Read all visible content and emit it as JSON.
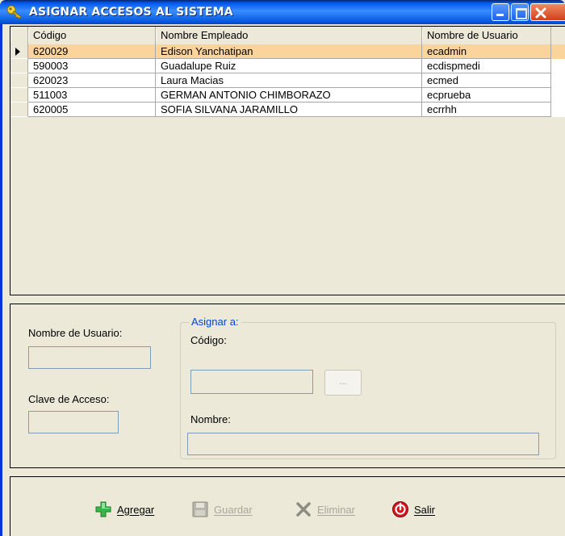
{
  "window": {
    "title": "ASIGNAR ACCESOS AL SISTEMA"
  },
  "grid": {
    "columns": [
      "Código",
      "Nombre Empleado",
      "Nombre de Usuario"
    ],
    "rows": [
      {
        "codigo": "620029",
        "nombre": "Edison Yanchatipan",
        "usuario": "ecadmin"
      },
      {
        "codigo": "590003",
        "nombre": "Guadalupe Ruiz",
        "usuario": "ecdispmedi"
      },
      {
        "codigo": "620023",
        "nombre": "Laura Macias",
        "usuario": "ecmed"
      },
      {
        "codigo": "511003",
        "nombre": "GERMAN ANTONIO CHIMBORAZO",
        "usuario": "ecprueba"
      },
      {
        "codigo": "620005",
        "nombre": "SOFIA SILVANA JARAMILLO",
        "usuario": "ecrrhh"
      }
    ],
    "selected_row": 0
  },
  "form": {
    "usuario_label": "Nombre de Usuario:",
    "usuario_value": "",
    "clave_label": "Clave de Acceso:",
    "clave_value": "",
    "group_title": "Asignar a:",
    "codigo_label": "Código:",
    "codigo_value": "",
    "browse_label": "...",
    "nombre_label": "Nombre:",
    "nombre_value": ""
  },
  "toolbar": {
    "agregar": "Agregar",
    "guardar": "Guardar",
    "eliminar": "Eliminar",
    "salir": "Salir"
  },
  "colors": {
    "selected_row": "#fbd49c",
    "group_title": "#0046d5",
    "titlebar": "#0058ee"
  },
  "icons": {
    "title": "key-icon",
    "agregar": "plus-icon",
    "guardar": "floppy-disk-icon",
    "eliminar": "x-icon",
    "salir": "power-icon"
  }
}
